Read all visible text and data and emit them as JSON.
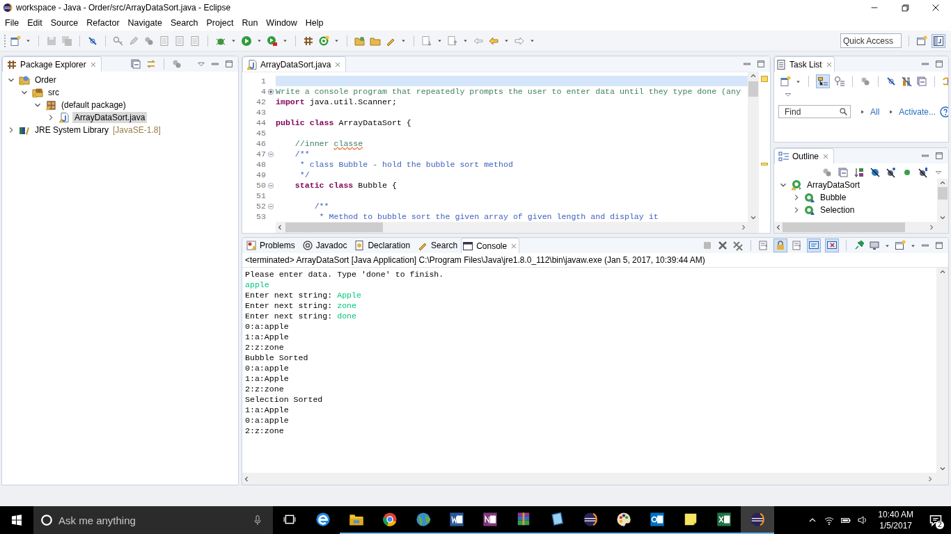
{
  "window": {
    "title": "workspace - Java - Order/src/ArrayDataSort.java - Eclipse"
  },
  "menu_bar": [
    "File",
    "Edit",
    "Source",
    "Refactor",
    "Navigate",
    "Search",
    "Project",
    "Run",
    "Window",
    "Help"
  ],
  "quick_access": {
    "placeholder": "Quick Access"
  },
  "package_explorer": {
    "title": "Package Explorer",
    "tree": [
      {
        "label": "Order",
        "kind": "project",
        "expanded": true,
        "selected": false,
        "children": [
          {
            "label": "src",
            "kind": "source-folder",
            "expanded": true,
            "selected": false,
            "children": [
              {
                "label": "(default package)",
                "kind": "package",
                "expanded": true,
                "selected": false,
                "children": [
                  {
                    "label": "ArrayDataSort.java",
                    "kind": "java-file",
                    "expanded": false,
                    "selected": true
                  }
                ]
              }
            ]
          }
        ]
      },
      {
        "label": "JRE System Library",
        "decoration": "[JavaSE-1.8]",
        "kind": "library",
        "expanded": false,
        "selected": false
      }
    ]
  },
  "editor": {
    "tab": "ArrayDataSort.java",
    "lines": [
      {
        "number": "1",
        "current": true
      },
      {
        "number": "4",
        "folded": true,
        "current": false,
        "tokens": [
          {
            "kind": "comment",
            "text": "Write a console program that repeatedly prompts the user to enter data until they type done (any"
          }
        ]
      },
      {
        "number": "42",
        "current": false,
        "tokens": [
          {
            "kind": "keyword",
            "text": "import"
          },
          {
            "kind": "plain",
            "text": " java.util.Scanner;"
          }
        ]
      },
      {
        "number": "43",
        "current": false
      },
      {
        "number": "44",
        "current": false,
        "tokens": [
          {
            "kind": "keyword",
            "text": "public class"
          },
          {
            "kind": "plain",
            "text": " ArrayDataSort {"
          }
        ]
      },
      {
        "number": "45",
        "current": false
      },
      {
        "number": "46",
        "current": false,
        "tokens": [
          {
            "kind": "comment",
            "text": "    //inner "
          },
          {
            "kind": "misspelled",
            "text": "classe"
          }
        ]
      },
      {
        "number": "47",
        "folded": false,
        "current": false,
        "tokens": [
          {
            "kind": "javadoc",
            "text": "    /**"
          }
        ]
      },
      {
        "number": "48",
        "current": false,
        "tokens": [
          {
            "kind": "javadoc",
            "text": "     * class Bubble - hold the bubble sort method"
          }
        ]
      },
      {
        "number": "49",
        "current": false,
        "tokens": [
          {
            "kind": "javadoc",
            "text": "     */"
          }
        ]
      },
      {
        "number": "50",
        "folded": false,
        "current": false,
        "tokens": [
          {
            "kind": "keyword",
            "text": "    static class"
          },
          {
            "kind": "plain",
            "text": " Bubble {"
          }
        ]
      },
      {
        "number": "51",
        "current": false
      },
      {
        "number": "52",
        "folded": false,
        "current": false,
        "tokens": [
          {
            "kind": "javadoc",
            "text": "        /**"
          }
        ]
      },
      {
        "number": "53",
        "current": false,
        "tokens": [
          {
            "kind": "javadoc",
            "text": "         * Method to bubble sort the given array of given length and display it"
          }
        ]
      }
    ]
  },
  "task_list": {
    "title": "Task List",
    "find": {
      "placeholder": "Find"
    },
    "links": [
      "All",
      "Activate..."
    ]
  },
  "outline": {
    "title": "Outline",
    "tree": [
      {
        "label": "ArrayDataSort",
        "expanded": true,
        "children": [
          {
            "label": "Bubble",
            "expanded": false
          },
          {
            "label": "Selection",
            "expanded": false
          }
        ]
      }
    ]
  },
  "bottom_panel": {
    "tabs": [
      {
        "label": "Problems",
        "kind": "problems",
        "selected": false
      },
      {
        "label": "Javadoc",
        "kind": "javadoc",
        "selected": false
      },
      {
        "label": "Declaration",
        "kind": "declaration",
        "selected": false
      },
      {
        "label": "Search",
        "kind": "search",
        "selected": false
      },
      {
        "label": "Console",
        "kind": "console",
        "selected": true
      }
    ],
    "status": "<terminated> ArrayDataSort [Java Application] C:\\Program Files\\Java\\jre1.8.0_112\\bin\\javaw.exe (Jan 5, 2017, 10:39:44 AM)",
    "lines": [
      {
        "segments": [
          {
            "kind": "output",
            "text": "Please enter data. Type 'done' to finish."
          }
        ]
      },
      {
        "segments": [
          {
            "kind": "input",
            "text": "apple"
          }
        ]
      },
      {
        "segments": [
          {
            "kind": "output",
            "text": "Enter next string: "
          },
          {
            "kind": "input",
            "text": "Apple"
          }
        ]
      },
      {
        "segments": [
          {
            "kind": "output",
            "text": "Enter next string: "
          },
          {
            "kind": "input",
            "text": "zone"
          }
        ]
      },
      {
        "segments": [
          {
            "kind": "output",
            "text": "Enter next string: "
          },
          {
            "kind": "input",
            "text": "done"
          }
        ]
      },
      {
        "segments": [
          {
            "kind": "output",
            "text": "0:a:apple"
          }
        ]
      },
      {
        "segments": [
          {
            "kind": "output",
            "text": "1:a:Apple"
          }
        ]
      },
      {
        "segments": [
          {
            "kind": "output",
            "text": "2:z:zone"
          }
        ]
      },
      {
        "segments": [
          {
            "kind": "output",
            "text": "Bubble Sorted"
          }
        ]
      },
      {
        "segments": [
          {
            "kind": "output",
            "text": "0:a:apple"
          }
        ]
      },
      {
        "segments": [
          {
            "kind": "output",
            "text": "1:a:Apple"
          }
        ]
      },
      {
        "segments": [
          {
            "kind": "output",
            "text": "2:z:zone"
          }
        ]
      },
      {
        "segments": [
          {
            "kind": "output",
            "text": "Selection Sorted"
          }
        ]
      },
      {
        "segments": [
          {
            "kind": "output",
            "text": "1:a:Apple"
          }
        ]
      },
      {
        "segments": [
          {
            "kind": "output",
            "text": "0:a:apple"
          }
        ]
      },
      {
        "segments": [
          {
            "kind": "output",
            "text": "2:z:zone"
          }
        ]
      }
    ]
  },
  "taskbar": {
    "search": {
      "placeholder": "Ask me anything"
    },
    "apps": [
      {
        "kind": "task-view",
        "running": false,
        "active": false
      },
      {
        "kind": "edge",
        "running": false,
        "active": false
      },
      {
        "kind": "file-explorer",
        "running": true,
        "active": false
      },
      {
        "kind": "chrome",
        "running": true,
        "active": false
      },
      {
        "kind": "globe",
        "running": true,
        "active": false
      },
      {
        "kind": "word",
        "running": true,
        "active": false
      },
      {
        "kind": "onenote",
        "running": true,
        "active": false
      },
      {
        "kind": "archive",
        "running": true,
        "active": false
      },
      {
        "kind": "notepad",
        "running": true,
        "active": false
      },
      {
        "kind": "eclipse",
        "running": true,
        "active": false
      },
      {
        "kind": "paint",
        "running": true,
        "active": false
      },
      {
        "kind": "outlook",
        "running": true,
        "active": false
      },
      {
        "kind": "sticky-notes",
        "running": true,
        "active": false
      },
      {
        "kind": "excel",
        "running": true,
        "active": false
      },
      {
        "kind": "eclipse",
        "running": true,
        "active": true
      }
    ],
    "clock": {
      "time": "10:40 AM",
      "date": "1/5/2017"
    },
    "notifications": "2"
  }
}
